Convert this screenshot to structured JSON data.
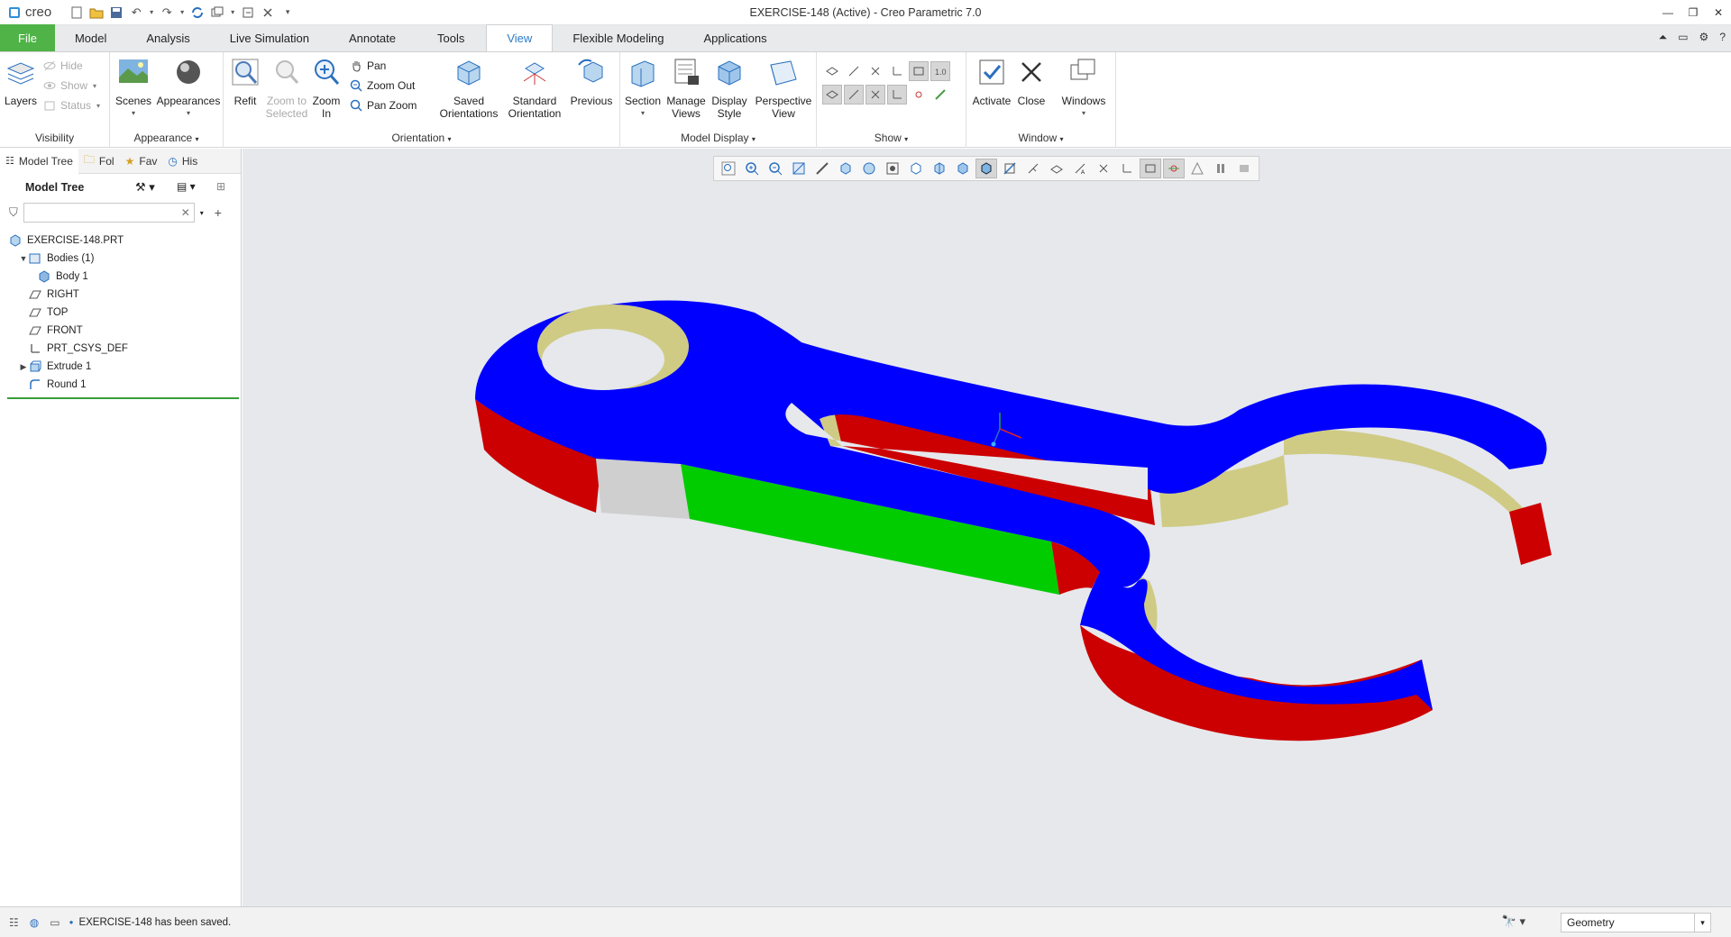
{
  "app": {
    "logo_text": "creo",
    "window_title": "EXERCISE-148 (Active) - Creo Parametric 7.0"
  },
  "ribbon_tabs": [
    "File",
    "Model",
    "Analysis",
    "Live Simulation",
    "Annotate",
    "Tools",
    "View",
    "Flexible Modeling",
    "Applications"
  ],
  "active_tab": "View",
  "groups": {
    "visibility": {
      "label": "Visibility",
      "layers": "Layers",
      "hide": "Hide",
      "show": "Show",
      "status": "Status"
    },
    "appearance": {
      "label": "Appearance",
      "scenes": "Scenes",
      "appearances": "Appearances"
    },
    "orientation": {
      "label": "Orientation",
      "refit": "Refit",
      "zoom_to_selected": "Zoom to Selected",
      "zoom_in": "Zoom In",
      "pan": "Pan",
      "zoom_out": "Zoom Out",
      "pan_zoom": "Pan Zoom",
      "saved_orientations": "Saved Orientations",
      "standard_orientation": "Standard Orientation",
      "previous": "Previous"
    },
    "model_display": {
      "label": "Model Display",
      "section": "Section",
      "manage_views": "Manage Views",
      "display_style": "Display Style",
      "perspective_view": "Perspective View"
    },
    "show": {
      "label": "Show"
    },
    "window": {
      "label": "Window",
      "activate": "Activate",
      "close": "Close",
      "windows": "Windows"
    }
  },
  "panel_tabs": [
    "Model Tree",
    "Fol",
    "Fav",
    "His"
  ],
  "model_tree": {
    "title": "Model Tree",
    "search_value": "",
    "nodes": [
      {
        "label": "EXERCISE-148.PRT",
        "icon": "part-icon",
        "indent": 0,
        "toggle": ""
      },
      {
        "label": "Bodies (1)",
        "icon": "bodies-icon",
        "indent": 1,
        "toggle": "expanded"
      },
      {
        "label": "Body 1",
        "icon": "body-icon",
        "indent": 2,
        "toggle": ""
      },
      {
        "label": "RIGHT",
        "icon": "datum-plane-icon",
        "indent": 1,
        "toggle": ""
      },
      {
        "label": "TOP",
        "icon": "datum-plane-icon",
        "indent": 1,
        "toggle": ""
      },
      {
        "label": "FRONT",
        "icon": "datum-plane-icon",
        "indent": 1,
        "toggle": ""
      },
      {
        "label": "PRT_CSYS_DEF",
        "icon": "csys-icon",
        "indent": 1,
        "toggle": ""
      },
      {
        "label": "Extrude 1",
        "icon": "extrude-icon",
        "indent": 1,
        "toggle": "collapsed"
      },
      {
        "label": "Round 1",
        "icon": "round-icon",
        "indent": 1,
        "toggle": ""
      }
    ]
  },
  "status": {
    "message": "EXERCISE-148 has been saved.",
    "filter_value": "Geometry"
  },
  "colors": {
    "top_face": "#0000ff",
    "side_red": "#cc0000",
    "side_green": "#00cc00",
    "inner_khaki": "#cfcb85",
    "side_gray": "#cfcfcf",
    "file_tab": "#4fb348",
    "background": "#e6e8ec"
  }
}
